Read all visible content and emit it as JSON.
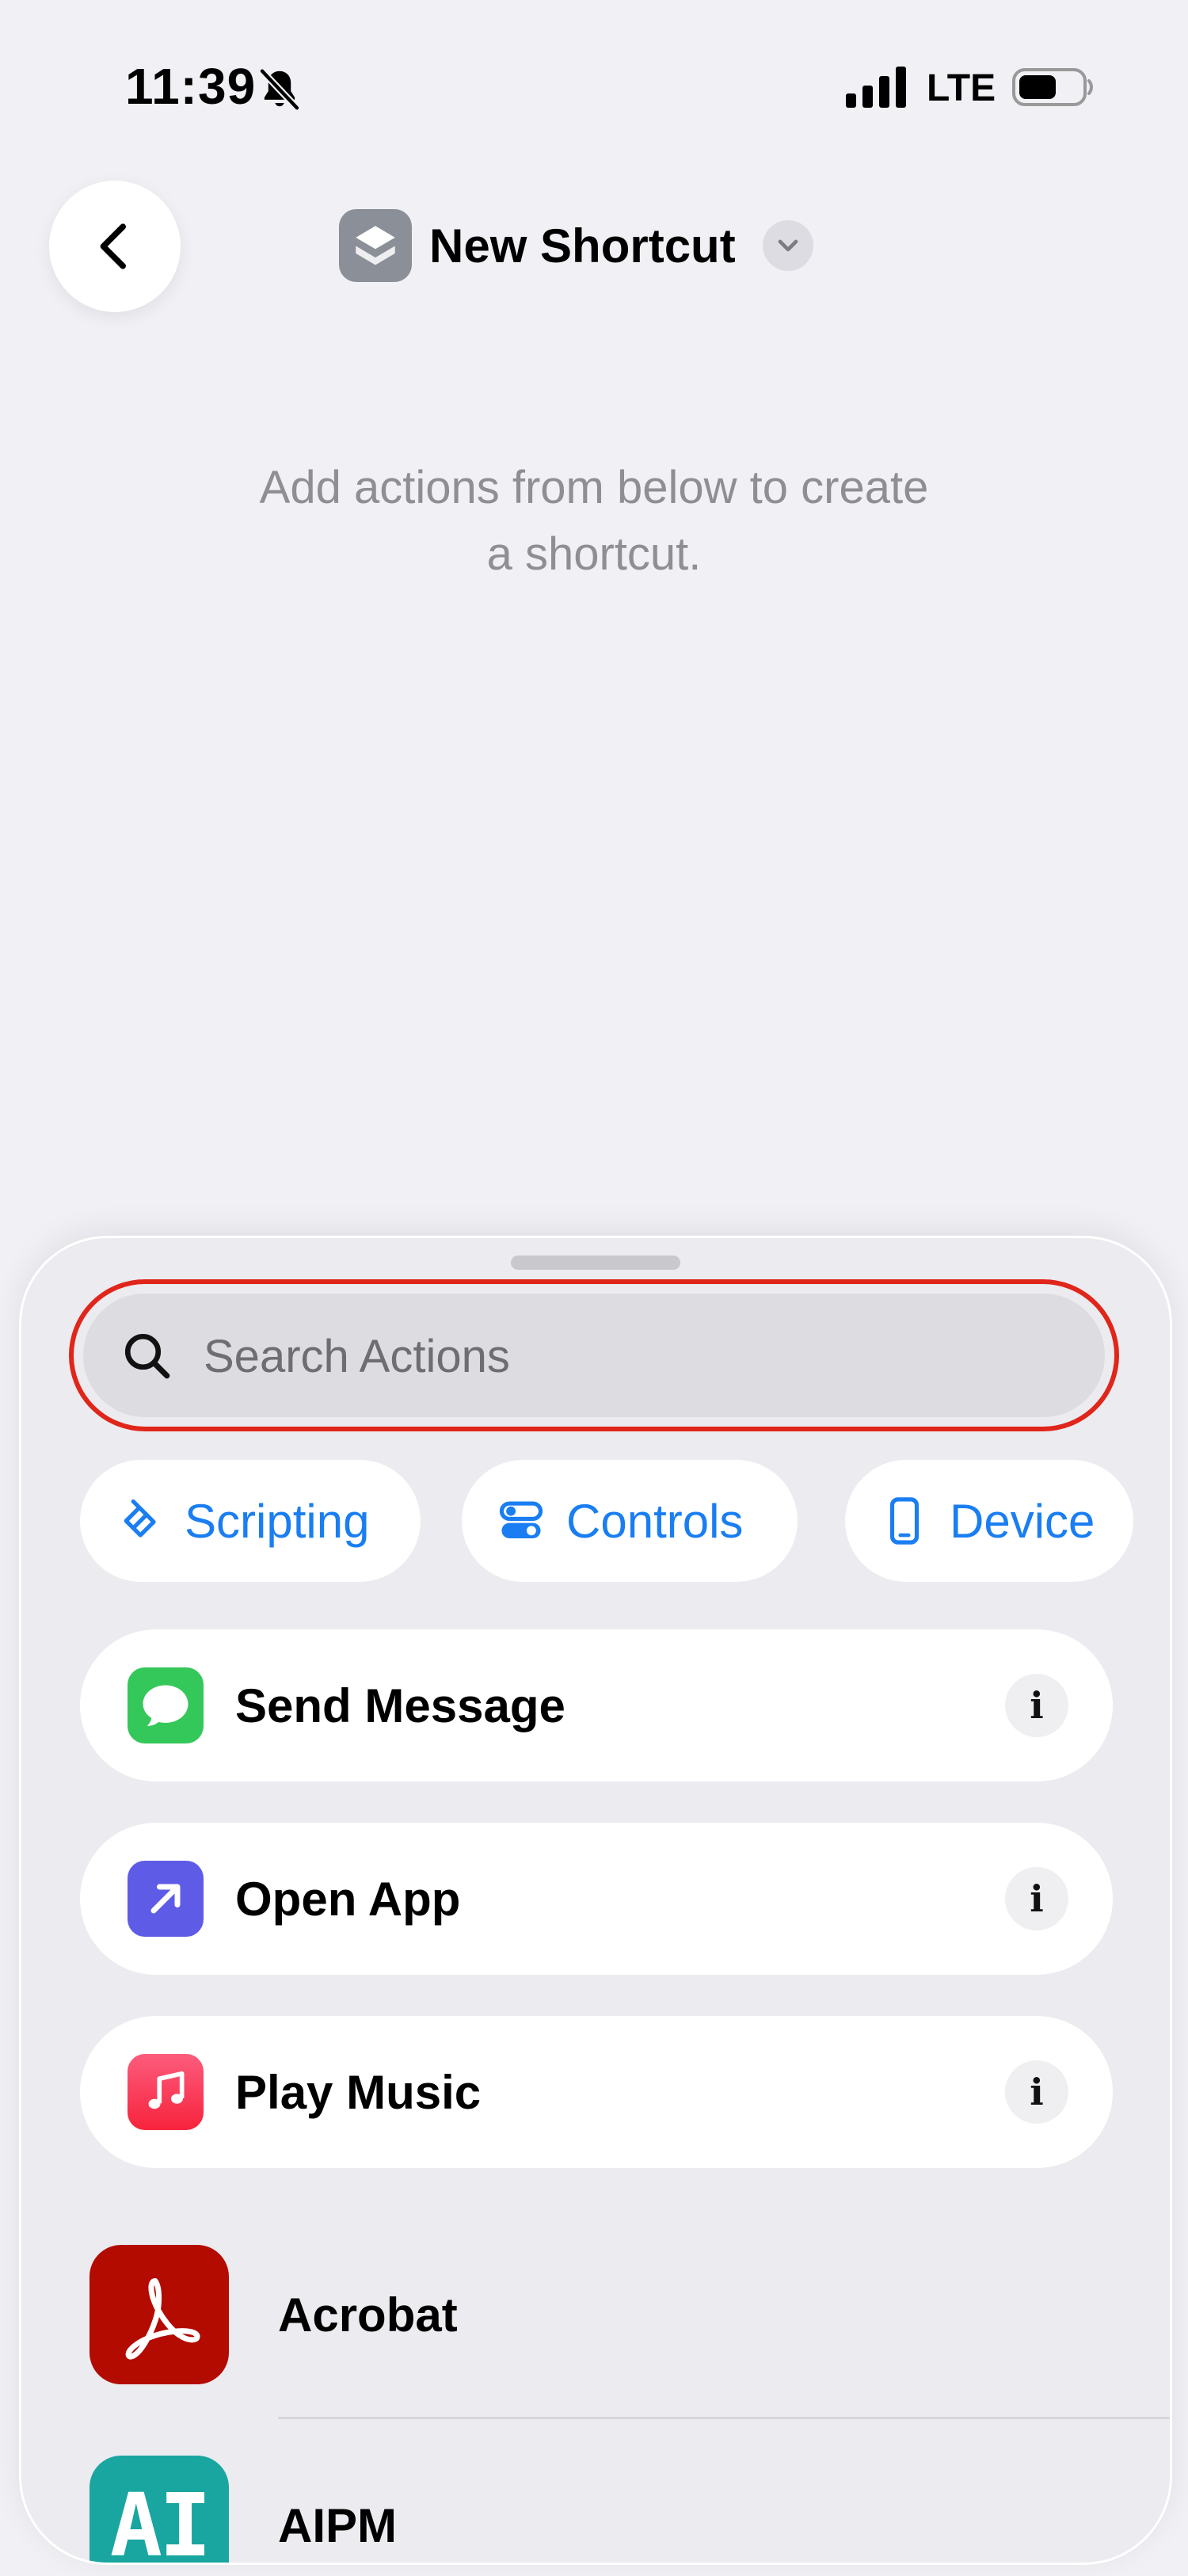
{
  "status_bar": {
    "time": "11:39",
    "network": "LTE",
    "icons": [
      "bell-slash-icon",
      "signal-icon",
      "battery-icon"
    ]
  },
  "nav": {
    "back_icon": "chevron-left-icon",
    "title": "New Shortcut",
    "title_icon": "shortcuts-icon",
    "menu_icon": "chevron-down-icon"
  },
  "empty_state": {
    "line1": "Add actions from below to create",
    "line2": "a shortcut."
  },
  "sheet": {
    "search": {
      "placeholder": "Search Actions",
      "value": "",
      "icon": "magnifier-icon"
    },
    "categories": [
      {
        "label": "Scripting",
        "icon": "scripting-icon"
      },
      {
        "label": "Controls",
        "icon": "toggles-icon"
      },
      {
        "label": "Device",
        "icon": "phone-icon"
      }
    ],
    "suggested_actions": [
      {
        "label": "Send Message",
        "icon": "messages-icon",
        "color": "#34c759"
      },
      {
        "label": "Open App",
        "icon": "arrow-up-right-icon",
        "color": "#5e5ce6"
      },
      {
        "label": "Play Music",
        "icon": "music-note-icon",
        "color": "#fa2d48"
      }
    ],
    "info_glyph": "i",
    "apps": [
      {
        "label": "Acrobat",
        "icon": "acrobat-icon",
        "color": "#b30b00"
      },
      {
        "label": "AIPM",
        "icon": "aipm-icon",
        "color": "#1aa6a0",
        "icon_text": "AI"
      }
    ]
  },
  "colors": {
    "accent": "#1a7ef2",
    "highlight": "#e0261a"
  }
}
